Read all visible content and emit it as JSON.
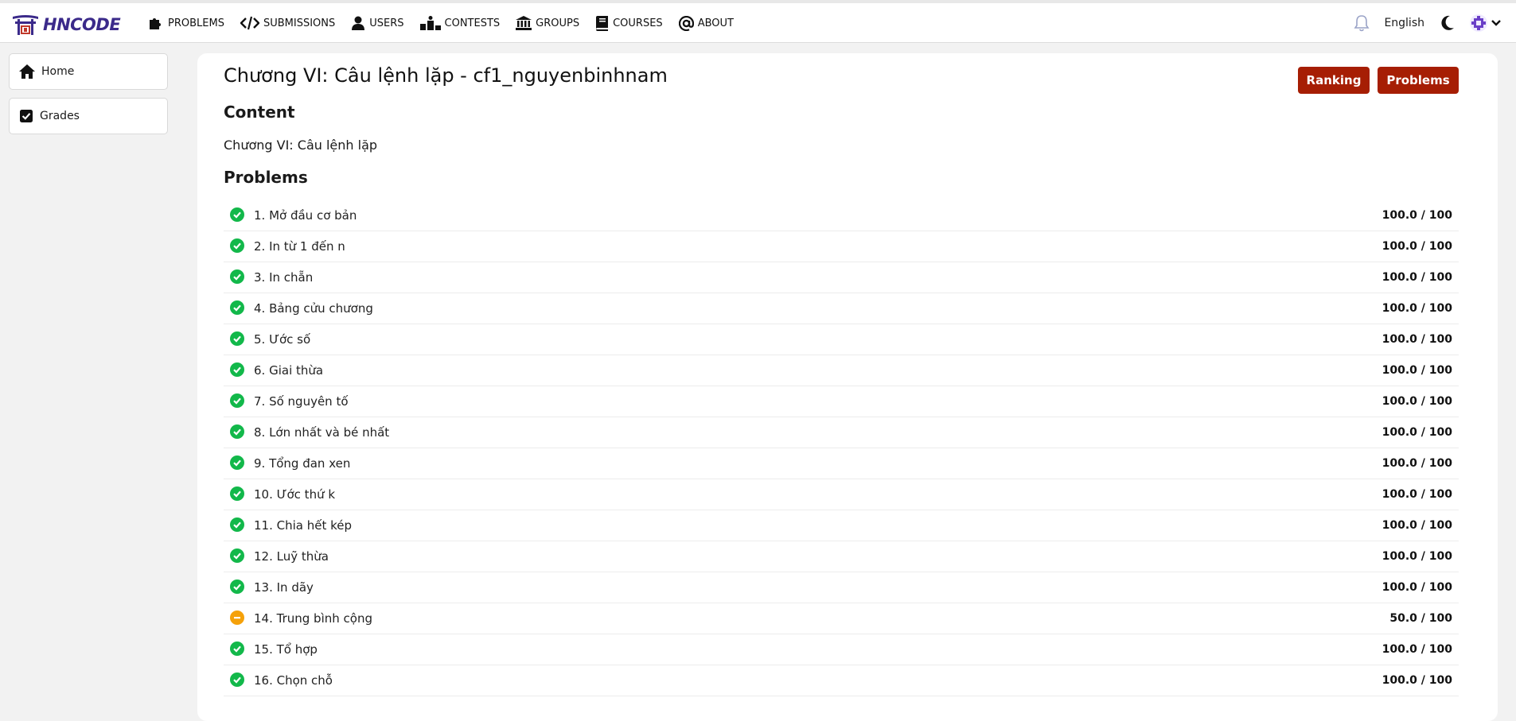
{
  "brand": {
    "name": "HNCODE"
  },
  "nav": [
    {
      "label": "PROBLEMS",
      "icon": "puzzle-icon"
    },
    {
      "label": "SUBMISSIONS",
      "icon": "code-icon"
    },
    {
      "label": "USERS",
      "icon": "user-icon"
    },
    {
      "label": "CONTESTS",
      "icon": "podium-icon"
    },
    {
      "label": "GROUPS",
      "icon": "institution-icon"
    },
    {
      "label": "COURSES",
      "icon": "book-icon"
    },
    {
      "label": "ABOUT",
      "icon": "at-icon"
    }
  ],
  "topbar": {
    "language": "English"
  },
  "sidebar": [
    {
      "label": "Home",
      "icon": "home-icon"
    },
    {
      "label": "Grades",
      "icon": "checkbox-icon"
    }
  ],
  "page": {
    "title": "Chương VI: Câu lệnh lặp - cf1_nguyenbinhnam",
    "ranking_label": "Ranking",
    "problems_label": "Problems",
    "content_heading": "Content",
    "content_text": "Chương VI: Câu lệnh lặp",
    "problems_heading": "Problems"
  },
  "colors": {
    "accent": "#a61e04",
    "success": "#12b84a",
    "partial": "#f5a10a"
  },
  "problems": [
    {
      "name": "1. Mở đầu cơ bản",
      "score": "100.0 / 100",
      "status": "accepted"
    },
    {
      "name": "2. In từ 1 đến n",
      "score": "100.0 / 100",
      "status": "accepted"
    },
    {
      "name": "3. In chẵn",
      "score": "100.0 / 100",
      "status": "accepted"
    },
    {
      "name": "4. Bảng cửu chương",
      "score": "100.0 / 100",
      "status": "accepted"
    },
    {
      "name": "5. Ước số",
      "score": "100.0 / 100",
      "status": "accepted"
    },
    {
      "name": "6. Giai thừa",
      "score": "100.0 / 100",
      "status": "accepted"
    },
    {
      "name": "7. Số nguyên tố",
      "score": "100.0 / 100",
      "status": "accepted"
    },
    {
      "name": "8. Lớn nhất và bé nhất",
      "score": "100.0 / 100",
      "status": "accepted"
    },
    {
      "name": "9. Tổng đan xen",
      "score": "100.0 / 100",
      "status": "accepted"
    },
    {
      "name": "10. Ước thứ k",
      "score": "100.0 / 100",
      "status": "accepted"
    },
    {
      "name": "11. Chia hết kép",
      "score": "100.0 / 100",
      "status": "accepted"
    },
    {
      "name": "12. Luỹ thừa",
      "score": "100.0 / 100",
      "status": "accepted"
    },
    {
      "name": "13. In dãy",
      "score": "100.0 / 100",
      "status": "accepted"
    },
    {
      "name": "14. Trung bình cộng",
      "score": "50.0 / 100",
      "status": "partial"
    },
    {
      "name": "15. Tổ hợp",
      "score": "100.0 / 100",
      "status": "accepted"
    },
    {
      "name": "16. Chọn chỗ",
      "score": "100.0 / 100",
      "status": "accepted"
    }
  ]
}
